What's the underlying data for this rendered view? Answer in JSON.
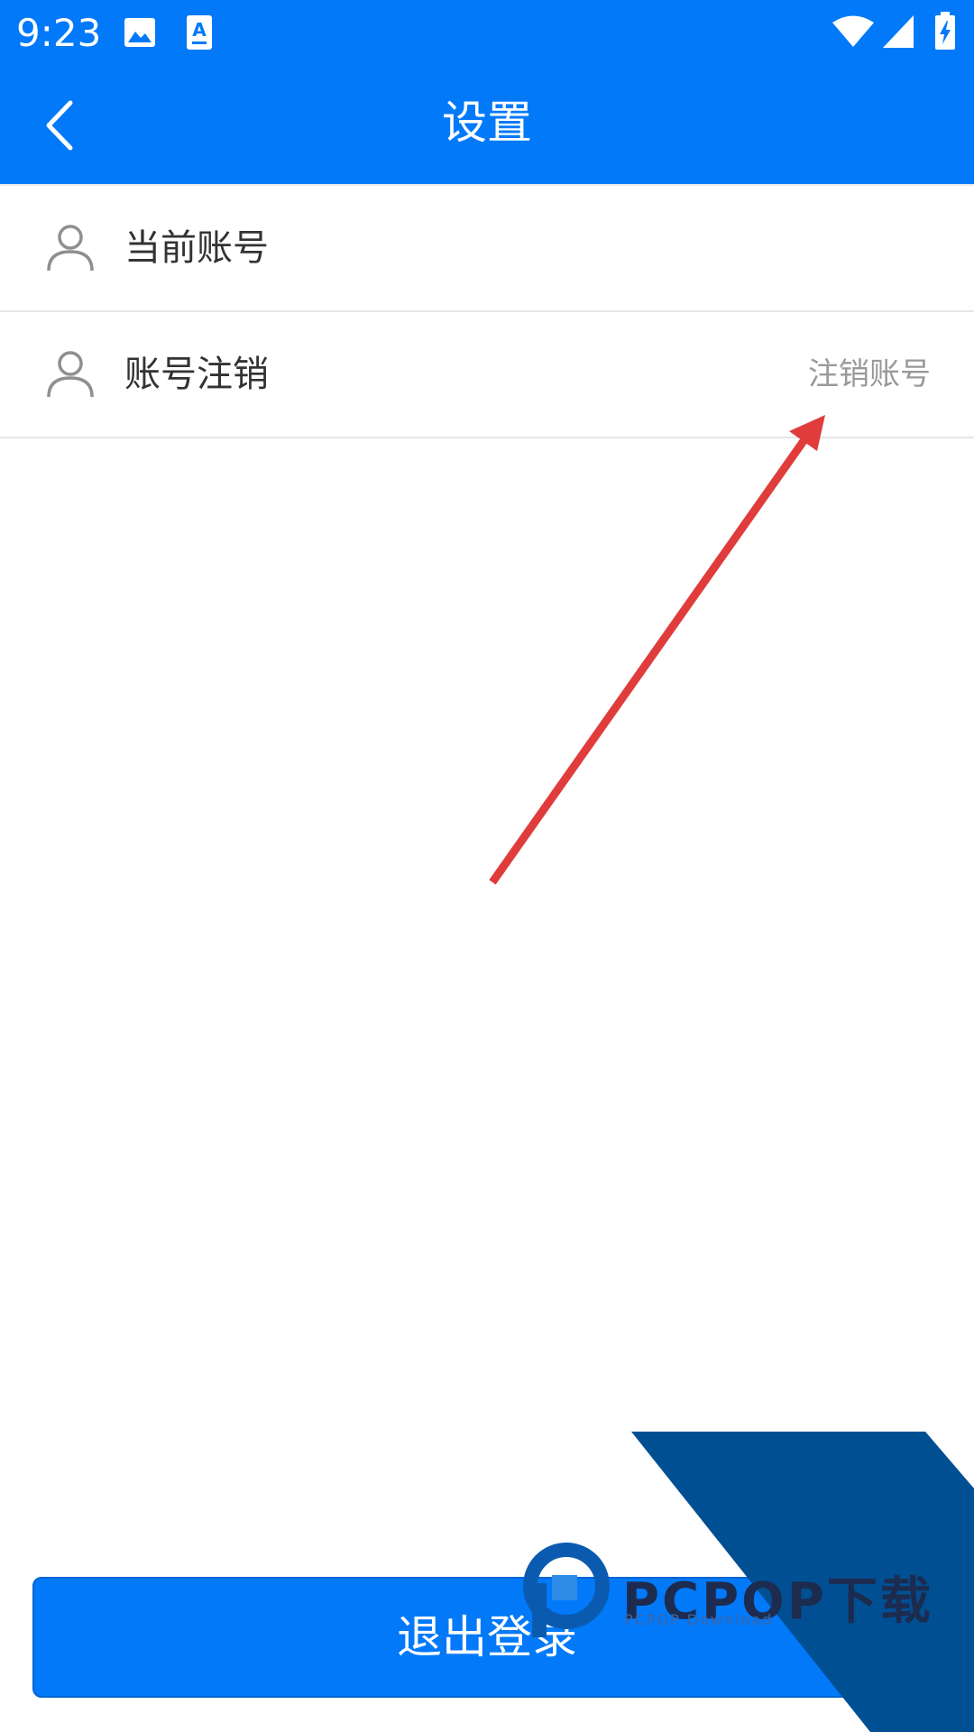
{
  "status_bar": {
    "time": "9:23",
    "icons": [
      "image-icon",
      "text-a-icon",
      "wifi-icon",
      "signal-icon",
      "battery-charging-icon"
    ]
  },
  "app_bar": {
    "title": "设置",
    "back_icon": "chevron-left-icon"
  },
  "settings": {
    "items": [
      {
        "label": "当前账号",
        "icon": "user-icon",
        "value": ""
      },
      {
        "label": "账号注销",
        "icon": "user-icon",
        "value": "注销账号"
      }
    ]
  },
  "logout": {
    "label": "退出登录"
  },
  "annotation": {
    "arrow_color": "#e03c3c"
  },
  "watermark": {
    "brand": "PCPOP下载",
    "subtitle": "PCPOP Download"
  },
  "colors": {
    "primary": "#0279f9",
    "text_primary": "#333333",
    "text_secondary": "#999999",
    "divider": "#e6e6e6",
    "watermark_band": "#004f93"
  }
}
